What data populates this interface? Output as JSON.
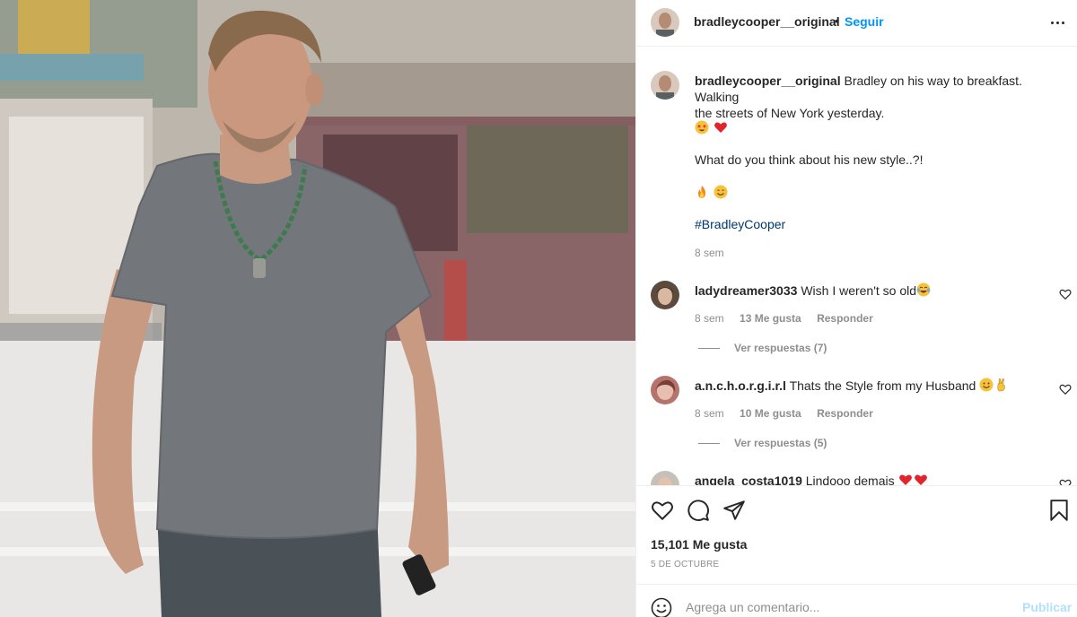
{
  "post": {
    "username": "bradleycooper__original",
    "dot": "•",
    "follow_label": "Seguir",
    "more_icon": "more-horizontal-icon"
  },
  "caption": {
    "username": "bradleycooper__original",
    "text_line1": "Bradley on his way to breakfast. Walking",
    "text_line2": "the streets of New York yesterday.",
    "emojis1": [
      "star-struck-emoji",
      "red-heart-emoji"
    ],
    "question": "What do you think about his new style..?!",
    "emojis2": [
      "fire-emoji",
      "smiling-face-emoji"
    ],
    "hashtag": "#BradleyCooper",
    "time": "8 sem"
  },
  "comments": [
    {
      "username": "ladydreamer3033",
      "text": "Wish I weren't so old",
      "emoji": "tears-of-joy-emoji",
      "time": "8 sem",
      "likes": "13 Me gusta",
      "reply": "Responder",
      "view_replies": "Ver respuestas (7)"
    },
    {
      "username": "a.n.c.h.o.r.g.i.r.l",
      "text": "Thats the Style from my Husband",
      "emoji": "smiling-face-emoji",
      "time": "8 sem",
      "likes": "10 Me gusta",
      "reply": "Responder",
      "view_replies": "Ver respuestas (5)"
    },
    {
      "username": "angela_costa1019",
      "text": "Lindooo demais",
      "emoji": "red-heart-emoji"
    }
  ],
  "actions": {
    "like_icon": "heart-icon",
    "comment_icon": "comment-icon",
    "share_icon": "paper-plane-icon",
    "save_icon": "bookmark-icon",
    "likes": "15,101 Me gusta",
    "date": "5 DE OCTUBRE"
  },
  "add_comment": {
    "placeholder": "Agrega un comentario...",
    "publish": "Publicar"
  },
  "colors": {
    "link_blue": "#0095f6",
    "hashtag": "#00376b",
    "muted": "#8e8e8e",
    "publish_disabled": "#b2dffc"
  }
}
